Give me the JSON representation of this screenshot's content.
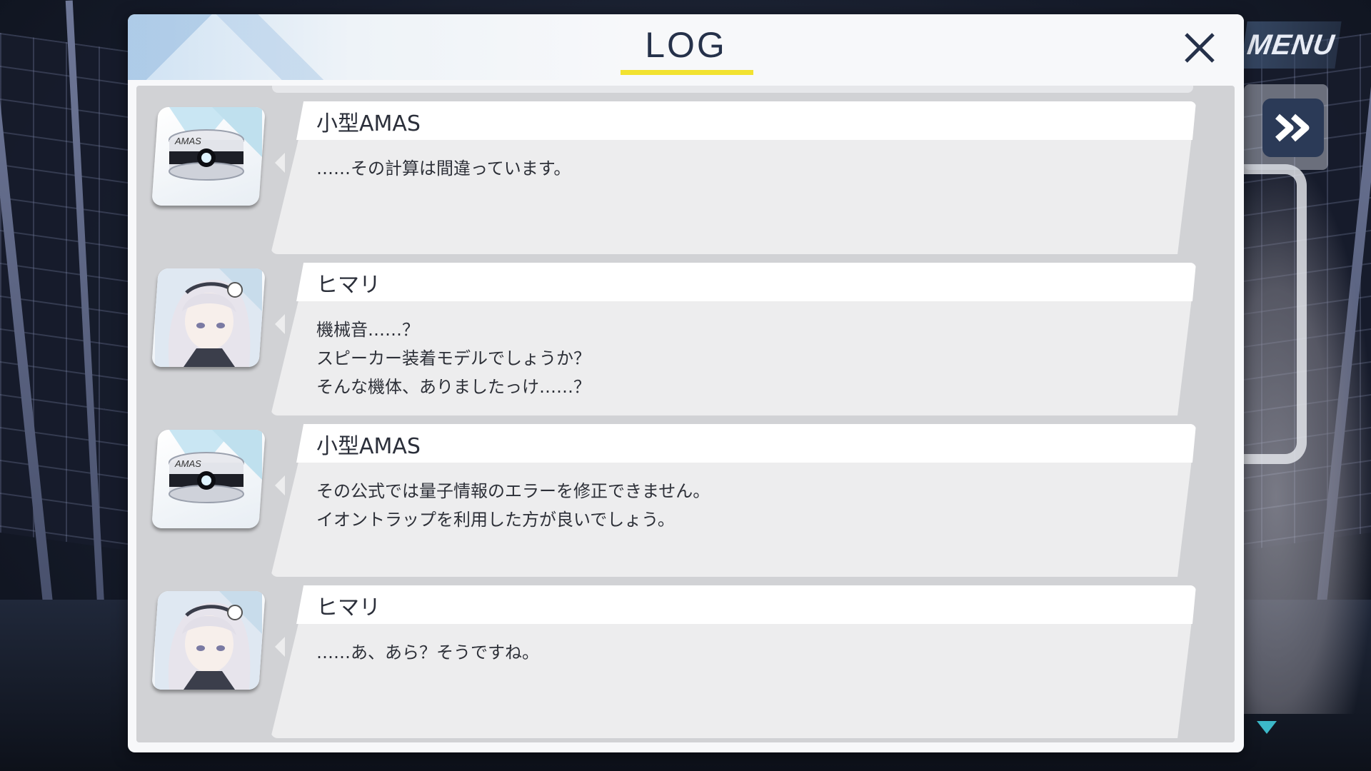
{
  "window": {
    "title": "LOG",
    "close_icon": "close-icon",
    "accent_color": "#f2e231"
  },
  "controls": {
    "menu_label": "MENU",
    "skip_icon": "fast-forward-icon",
    "scroll_icon": "scroll-down-triangle-icon"
  },
  "entries": [
    {
      "speaker": "小型AMAS",
      "avatar": "amas-device-avatar",
      "lines": [
        "……その計算は間違っています。"
      ]
    },
    {
      "speaker": "ヒマリ",
      "avatar": "himari-portrait-avatar",
      "lines": [
        "機械音……？",
        "スピーカー装着モデルでしょうか？",
        "そんな機体、ありましたっけ……？"
      ]
    },
    {
      "speaker": "小型AMAS",
      "avatar": "amas-device-avatar",
      "lines": [
        "その公式では量子情報のエラーを修正できません。",
        "イオントラップを利用した方が良いでしょう。"
      ]
    },
    {
      "speaker": "ヒマリ",
      "avatar": "himari-portrait-avatar",
      "lines": [
        "……あ、あら？そうですね。"
      ]
    }
  ]
}
